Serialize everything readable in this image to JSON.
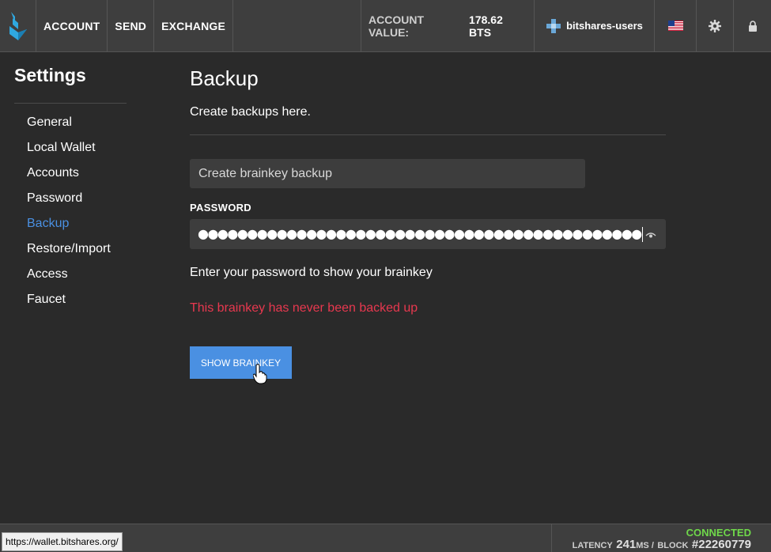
{
  "nav": {
    "items": [
      "ACCOUNT",
      "SEND",
      "EXCHANGE"
    ],
    "account_value_label": "ACCOUNT VALUE:",
    "account_value": "178.62 BTS",
    "account_name": "bitshares-users"
  },
  "sidebar": {
    "title": "Settings",
    "items": [
      {
        "label": "General",
        "active": false
      },
      {
        "label": "Local Wallet",
        "active": false
      },
      {
        "label": "Accounts",
        "active": false
      },
      {
        "label": "Password",
        "active": false
      },
      {
        "label": "Backup",
        "active": true
      },
      {
        "label": "Restore/Import",
        "active": false
      },
      {
        "label": "Access",
        "active": false
      },
      {
        "label": "Faucet",
        "active": false
      }
    ]
  },
  "main": {
    "title": "Backup",
    "description": "Create backups here.",
    "backup_type": "Create brainkey backup",
    "password_label": "PASSWORD",
    "password_value": "●●●●●●●●●●●●●●●●●●●●●●●●●●●●●●●●●●●●●●●●●●●●●",
    "hint": "Enter your password to show your brainkey",
    "warning": "This brainkey has never been backed up",
    "button_label": "SHOW BRAINKEY"
  },
  "footer": {
    "status_url": "https://wallet.bitshares.org/",
    "connection": "CONNECTED",
    "latency_label": "LATENCY",
    "latency_value": "241",
    "latency_unit": "MS /",
    "block_label": "BLOCK",
    "block_value": "#22260779"
  },
  "colors": {
    "accent": "#4a90e2",
    "warning": "#e8384f",
    "connected": "#6fd84a",
    "background": "#2a2a2a",
    "topbar": "#3e3e3e"
  },
  "icons": [
    "bitshares-logo-icon",
    "account-avatar-icon",
    "us-flag-icon",
    "gear-icon",
    "lock-icon",
    "eye-icon",
    "hand-cursor-icon"
  ]
}
